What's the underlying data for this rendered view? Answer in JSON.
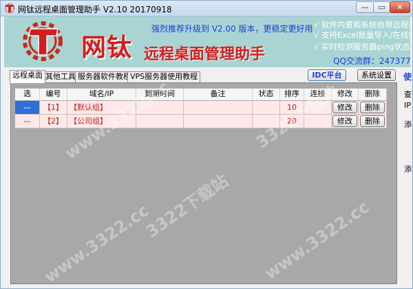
{
  "window": {
    "title": "网钛远程桌面管理助手 V2.10 20170918",
    "min_label": "—",
    "max_label": "▭",
    "close_label": "✕"
  },
  "banner": {
    "title_main": "网钛",
    "title_sub": "远程桌面管理助手",
    "promo": "强烈推荐升级到 V2.00 版本，更稳定更好用",
    "features": [
      "√ 软件内置和系统自带远程桌",
      "√ 支持Excel批量导入/在线批",
      "√ 实时检测服务器ping状态或"
    ],
    "qq": "QQ交流群：247377"
  },
  "tabs": [
    {
      "label": "远程桌面"
    },
    {
      "label": "其他工具"
    },
    {
      "label": "服务器软件教程"
    },
    {
      "label": "VPS服务器使用教程"
    }
  ],
  "toolbar": {
    "idc_label": "IDC平台",
    "settings_label": "系统设置",
    "side_link": "使"
  },
  "table": {
    "columns": [
      "选",
      "编号",
      "域名/IP",
      "到期时间",
      "备注",
      "状态",
      "排序",
      "连接",
      "修改",
      "删除"
    ],
    "rows": [
      {
        "select": "—",
        "id": "【1】",
        "domain": "【默认组】",
        "expire": "",
        "note": "",
        "status": "",
        "order": "10",
        "connect": "",
        "edit": "修改",
        "delete": "删除"
      },
      {
        "select": "—",
        "id": "【2】",
        "domain": "【公司组】",
        "expire": "",
        "note": "",
        "status": "",
        "order": "20",
        "connect": "",
        "edit": "修改",
        "delete": "删除"
      }
    ]
  },
  "right_panel": {
    "labels": [
      "查",
      "IP",
      "添",
      "添"
    ]
  },
  "watermarks": [
    "www.3322.cc",
    "3322下载站"
  ],
  "colors": {
    "banner_bg": "#a8d4d3",
    "title_red": "#d21e1e",
    "link_blue": "#1e3ed8",
    "row_pink": "#fde9e9",
    "selected_blue": "#2f6fd8",
    "grid_bg": "#a8a8a8"
  }
}
